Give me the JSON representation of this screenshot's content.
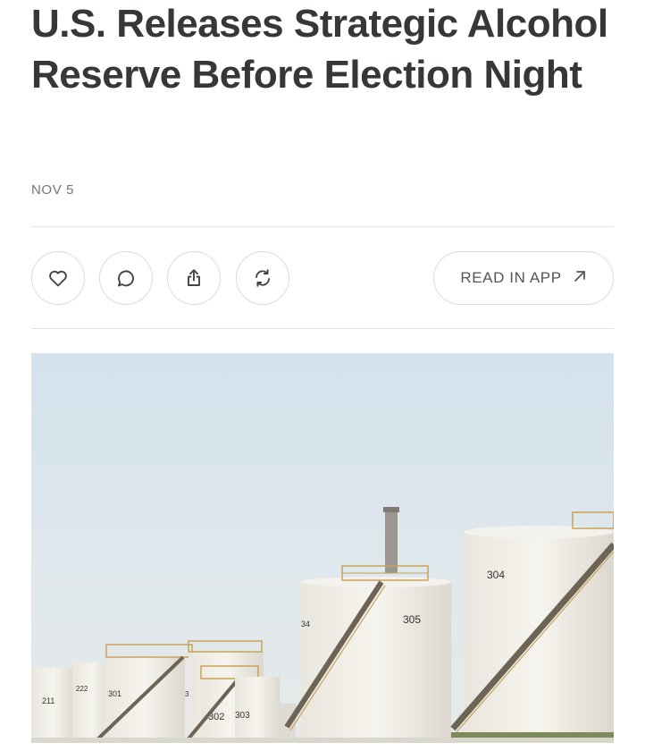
{
  "article": {
    "title": "U.S. Releases Strategic Alcohol Reserve Before Election Night",
    "date": "NOV 5"
  },
  "actions": {
    "like_icon": "heart-icon",
    "comment_icon": "comment-bubble-icon",
    "share_icon": "share-icon",
    "restack_icon": "restack-icon",
    "read_in_app_label": "READ IN APP",
    "read_in_app_icon": "arrow-up-right-icon"
  },
  "hero_image": {
    "tank_labels": [
      "305",
      "304",
      "302",
      "303",
      "301",
      "222",
      "211",
      "34",
      "3"
    ]
  },
  "colors": {
    "headline": "#363737",
    "muted_text": "#757575",
    "border": "#dcdcdc",
    "sky": "#dce6ec",
    "tank": "#f1eee6"
  }
}
